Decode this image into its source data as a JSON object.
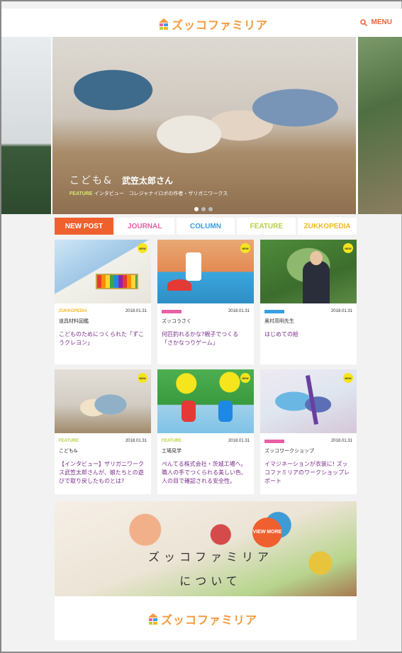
{
  "header": {
    "logo_text": "ズッコファミリア",
    "menu_label": "MENU"
  },
  "hero": {
    "brand": "こども&",
    "name": "武笠太郎さん",
    "feature_label": "FEATURE",
    "subtitle": "インタビュー　コレジャナイロボの作者・ザリガニワークス",
    "slides": 3,
    "active_slide": 1
  },
  "tabs": [
    {
      "label": "NEW POST",
      "color": "#ffffff",
      "active": true
    },
    {
      "label": "JOURNAL",
      "color": "#e85fa6"
    },
    {
      "label": "COLUMN",
      "color": "#3a9fe0"
    },
    {
      "label": "FEATURE",
      "color": "#b6d23a"
    },
    {
      "label": "ZUKKOPEDIA",
      "color": "#f2b81e"
    }
  ],
  "badge_label": "NEW",
  "cards": [
    {
      "category": "ZUKKOPEDIA",
      "cat_color": "#f2b81e",
      "date": "2018.01.31",
      "sub": "道具材料図鑑",
      "title": "こどものためにつくられた「ずこうクレヨン」"
    },
    {
      "category": "",
      "cat_color": "#e85fa6",
      "date": "2018.01.31",
      "sub": "ズッコうさく",
      "title": "何匹釣れるかな?親子でつくる「さかなつりゲーム」"
    },
    {
      "category": "",
      "cat_color": "#3a9fe0",
      "date": "2018.01.31",
      "sub": "奥村高明先生",
      "title": "はじめての絵"
    },
    {
      "category": "FEATURE",
      "cat_color": "#b6d23a",
      "date": "2018.01.31",
      "sub": "こども&",
      "title": "【インタビュー】ザリガニワークス武笠太郎さんが、娘たちとの遊びで取り戻したものとは?"
    },
    {
      "category": "FEATURE",
      "cat_color": "#b6d23a",
      "date": "2018.01.31",
      "sub": "工場見学",
      "title": "ぺんてる株式会社・茨城工場へ。職人の手でつくられる美しい色、人の目で確認される安全性。"
    },
    {
      "category": "",
      "cat_color": "#e85fa6",
      "date": "2018.01.31",
      "sub": "ズッコワークショップ",
      "title": "イマジネーションが衣装に! ズッコファミリアのワークショップレポート"
    }
  ],
  "banner": {
    "line1": "ズッコファミリア",
    "line2": "について",
    "view_more": "VIEW MORE",
    "logo_text": "ズッコファミリア"
  }
}
